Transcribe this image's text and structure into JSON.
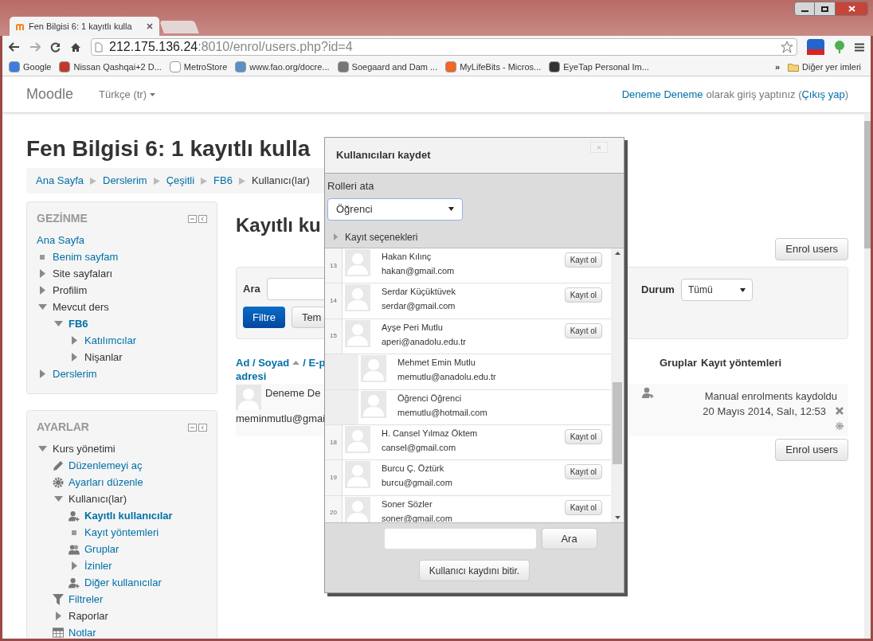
{
  "browser": {
    "tab_title": "Fen Bilgisi 6: 1 kayıtlı kulla",
    "url_host": "212.175.136.24",
    "url_rest": ":8010/enrol/users.php?id=4",
    "bookmarks": [
      {
        "label": "Google",
        "color": "#3b7ddd"
      },
      {
        "label": "Nissan Qashqai+2 D...",
        "color": "#c0392b"
      },
      {
        "label": "MetroStore",
        "color": "#ffffff"
      },
      {
        "label": "www.fao.org/docre...",
        "color": "#5b8fc7"
      },
      {
        "label": "Soegaard and Dam ...",
        "color": "#777777"
      },
      {
        "label": "MyLifeBits - Micros...",
        "color": "#f26522"
      },
      {
        "label": "EyeTap Personal Im...",
        "color": "#333333"
      }
    ],
    "more": "»",
    "other_bookmarks": "Diğer yer imleri"
  },
  "navbar": {
    "brand": "Moodle",
    "language": "Türkçe (tr)",
    "user_link": "Deneme Deneme",
    "login_text": "olarak giriş yaptınız (",
    "logout_link": "Çıkış yap",
    "login_end": ")"
  },
  "page_title": "Fen Bilgisi 6: 1 kayıtlı kulla",
  "breadcrumb": [
    {
      "label": "Ana Sayfa",
      "link": true
    },
    {
      "label": "Derslerim",
      "link": true
    },
    {
      "label": "Çeşitli",
      "link": true
    },
    {
      "label": "FB6",
      "link": true
    },
    {
      "label": "Kullanıcı(lar)",
      "link": false
    }
  ],
  "blocks": [
    {
      "title": "GEZİNME",
      "items": [
        {
          "label": "Ana Sayfa",
          "kind": "none",
          "link": true,
          "current": false
        },
        {
          "label": "Benim sayfam",
          "kind": "bullet",
          "link": true,
          "current": false
        },
        {
          "label": "Site sayfaları",
          "kind": "branch",
          "expanded": false,
          "link": false,
          "current": false
        },
        {
          "label": "Profilim",
          "kind": "branch",
          "expanded": false,
          "link": false,
          "current": false
        },
        {
          "label": "Mevcut ders",
          "kind": "branch",
          "expanded": true,
          "link": false,
          "current": false,
          "children": [
            {
              "label": "FB6",
              "kind": "branch",
              "expanded": true,
              "link": true,
              "current": true,
              "children": [
                {
                  "label": "Katılımcılar",
                  "kind": "branch",
                  "expanded": false,
                  "link": true,
                  "current": false
                },
                {
                  "label": "Nişanlar",
                  "kind": "branch",
                  "expanded": false,
                  "link": false,
                  "current": false
                }
              ]
            }
          ]
        },
        {
          "label": "Derslerim",
          "kind": "branch",
          "expanded": false,
          "link": true,
          "current": false
        }
      ]
    },
    {
      "title": "AYARLAR",
      "items": [
        {
          "label": "Kurs yönetimi",
          "kind": "branch",
          "expanded": true,
          "link": false,
          "current": false,
          "children": [
            {
              "label": "Düzenlemeyi aç",
              "kind": "pencil",
              "link": true,
              "current": false
            },
            {
              "label": "Ayarları düzenle",
              "kind": "gear",
              "link": true,
              "current": false
            },
            {
              "label": "Kullanıcı(lar)",
              "kind": "branch",
              "expanded": true,
              "link": false,
              "current": false,
              "children": [
                {
                  "label": "Kayıtlı kullanıcılar",
                  "kind": "user-add",
                  "link": true,
                  "current": true
                },
                {
                  "label": "Kayıt yöntemleri",
                  "kind": "bullet",
                  "link": true,
                  "current": false
                },
                {
                  "label": "Gruplar",
                  "kind": "users",
                  "link": true,
                  "current": false
                },
                {
                  "label": "İzinler",
                  "kind": "branch",
                  "expanded": false,
                  "link": true,
                  "current": false
                },
                {
                  "label": "Diğer kullanıcılar",
                  "kind": "user-add",
                  "link": true,
                  "current": false
                }
              ]
            },
            {
              "label": "Filtreler",
              "kind": "filter",
              "link": true,
              "current": false
            },
            {
              "label": "Raporlar",
              "kind": "branch",
              "expanded": false,
              "link": false,
              "current": false
            },
            {
              "label": "Notlar",
              "kind": "table",
              "link": true,
              "current": false
            }
          ]
        }
      ]
    }
  ],
  "main": {
    "heading": "Kayıtlı ku",
    "enrol_button": "Enrol users",
    "filter": {
      "search_label": "Ara",
      "filter_button": "Filtre",
      "reset_button": "Tem",
      "status_label": "Durum",
      "status_value": "Tümü"
    },
    "table": {
      "name_header": "Ad / Soyad",
      "email_header": "/ E-p",
      "email_header_2": "adresi",
      "groups_header": "Gruplar",
      "methods_header": "Kayıt yöntemleri",
      "rows": [
        {
          "name": "Deneme De",
          "email": "meminmutlu@gmai",
          "method": "Manual enrolments kaydoldu",
          "date": "20 Mayıs 2014, Salı, 12:53"
        }
      ]
    },
    "enrol_button_bottom": "Enrol users"
  },
  "modal": {
    "title": "Kullanıcıları kaydet",
    "close": "×",
    "roles_label": "Rolleri ata",
    "role": "Öğrenci",
    "options": "Kayıt seçenekleri",
    "users": [
      {
        "number": "13",
        "name": "Hakan Kılınç",
        "email": "hakan@gmail.com",
        "enrolled": false,
        "button": "Kayıt ol"
      },
      {
        "number": "14",
        "name": "Serdar Küçüktüvek",
        "email": "serdar@gmail.com",
        "enrolled": false,
        "button": "Kayıt ol"
      },
      {
        "number": "15",
        "name": "Ayşe Peri Mutlu",
        "email": "aperi@anadolu.edu.tr",
        "enrolled": false,
        "button": "Kayıt ol"
      },
      {
        "name": "Mehmet Emin Mutlu",
        "email": "memutlu@anadolu.edu.tr",
        "enrolled": true
      },
      {
        "name": "Öğrenci Öğrenci",
        "email": "memutlu@hotmail.com",
        "enrolled": true
      },
      {
        "number": "18",
        "name": "H. Cansel Yılmaz Öktem",
        "email": "cansel@gmail.com",
        "enrolled": false,
        "button": "Kayıt ol"
      },
      {
        "number": "19",
        "name": "Burcu Ç. Öztürk",
        "email": "burcu@gmail.com",
        "enrolled": false,
        "button": "Kayıt ol"
      },
      {
        "number": "20",
        "name": "Soner Sözler",
        "email": "soner@gmail.com",
        "enrolled": false,
        "button": "Kayıt ol"
      }
    ],
    "search_button": "Ara",
    "finish_button": "Kullanıcı kaydını bitir."
  }
}
